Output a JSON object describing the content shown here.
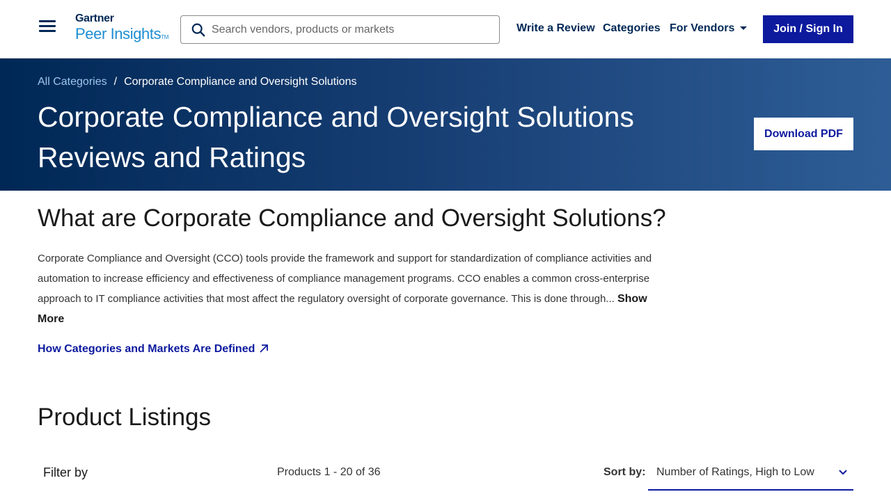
{
  "header": {
    "logo_top": "Gartner",
    "logo_bottom": "Peer Insights",
    "logo_tm": "TM",
    "search_placeholder": "Search vendors, products or markets",
    "nav": {
      "write_review": "Write a Review",
      "categories": "Categories",
      "for_vendors": "For Vendors"
    },
    "join_label": "Join / Sign In"
  },
  "hero": {
    "breadcrumb_root": "All Categories",
    "breadcrumb_separator": "/",
    "breadcrumb_current": "Corporate Compliance and Oversight Solutions",
    "title": "Corporate Compliance and Oversight Solutions Reviews and Ratings",
    "download_label": "Download PDF"
  },
  "about": {
    "title": "What are Corporate Compliance and Oversight Solutions?",
    "description": "Corporate Compliance and Oversight (CCO) tools provide the framework and support for standardization of compliance activities and automation to increase efficiency and effectiveness of compliance management programs. CCO enables a common cross-enterprise approach to IT compliance activities that most affect the regulatory oversight of corporate governance. This is done through...",
    "show_more": "Show More",
    "how_link": "How Categories and Markets Are Defined"
  },
  "listings": {
    "title": "Product Listings",
    "filter_label": "Filter by",
    "count": "Products 1 - 20 of 36",
    "sort_label": "Sort by:",
    "sort_value": "Number of Ratings, High to Low"
  },
  "colors": {
    "brand_navy": "#002856",
    "accent_blue": "#0d1a9e",
    "logo_blue": "#1f8fd1"
  },
  "icons": [
    "menu-icon",
    "search-icon",
    "caret-down-icon",
    "external-arrow-icon",
    "chevron-down-icon"
  ]
}
